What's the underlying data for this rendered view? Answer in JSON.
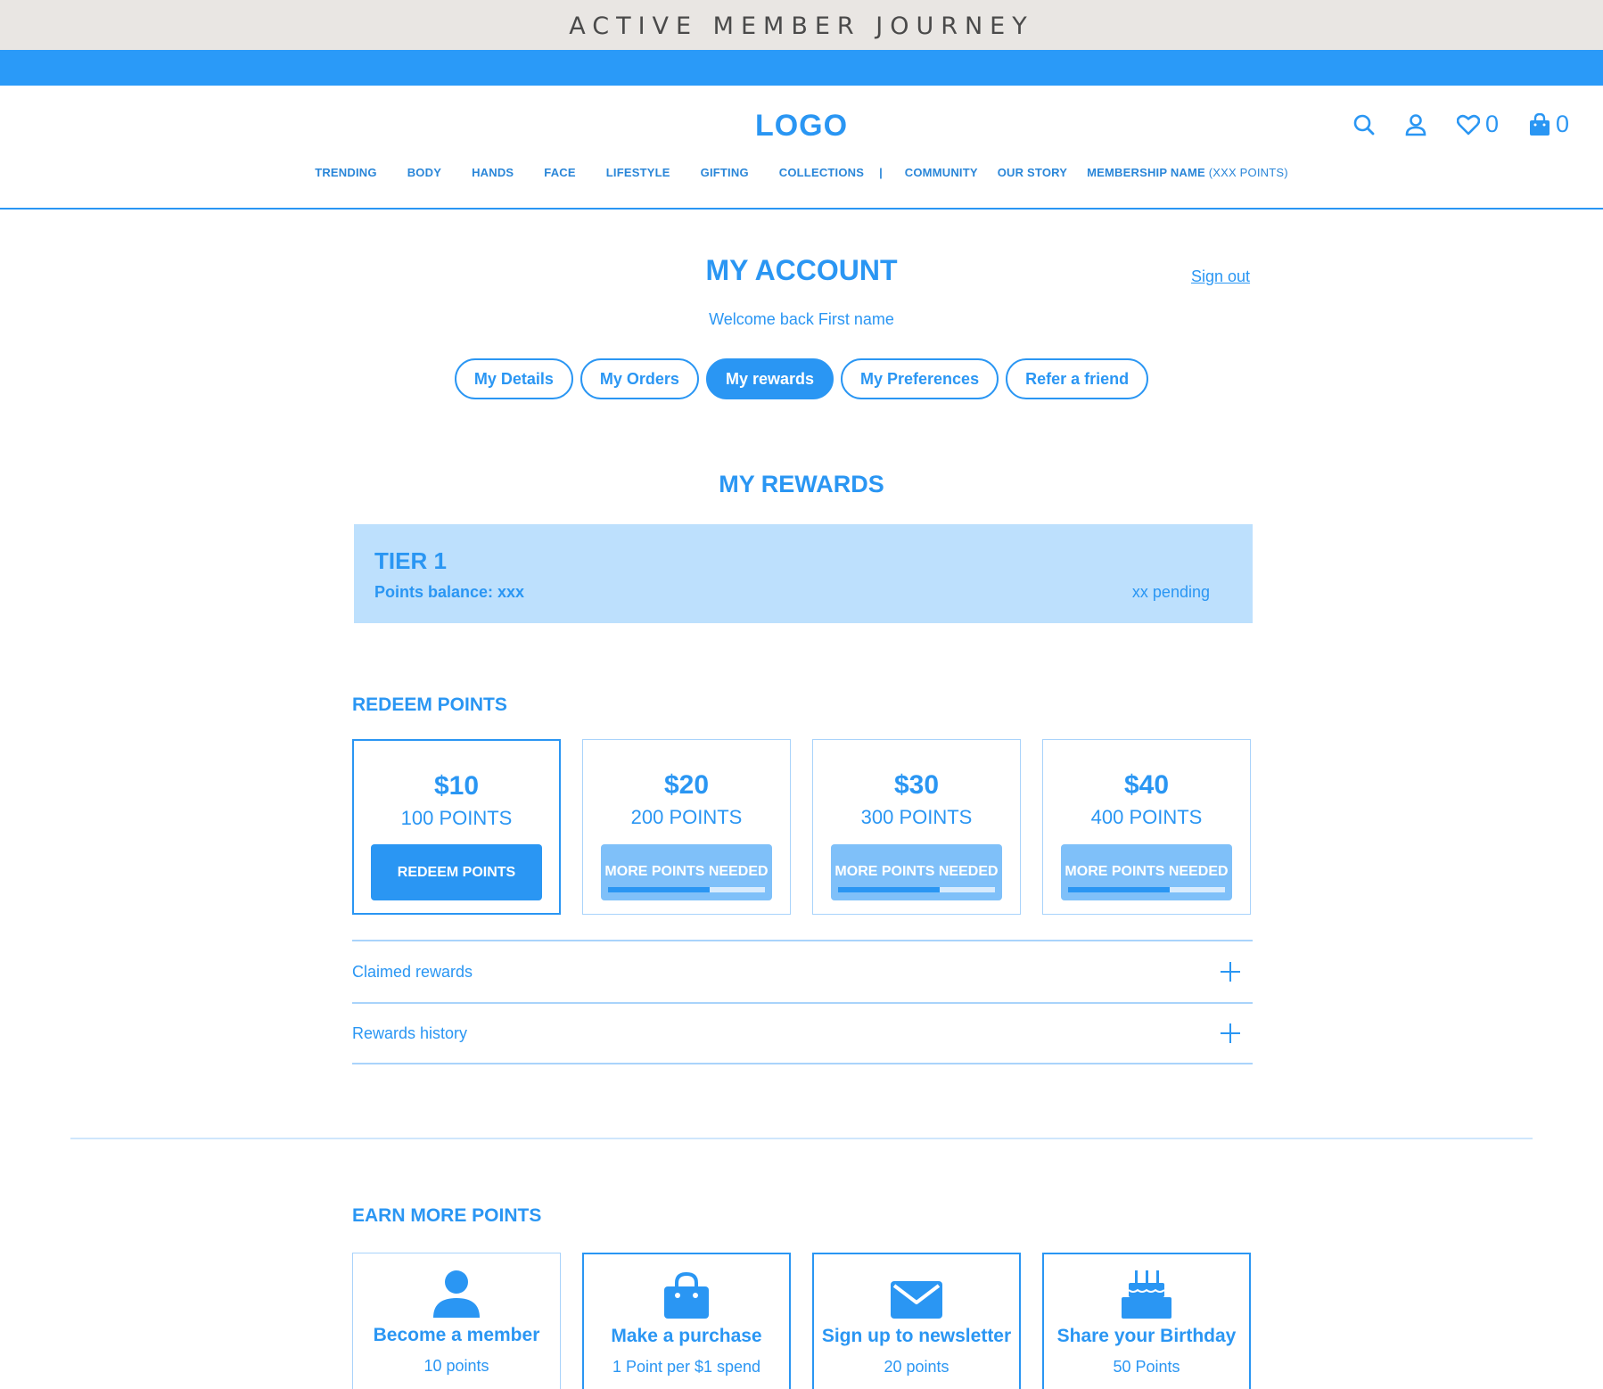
{
  "banner": {
    "title": "ACTIVE MEMBER JOURNEY"
  },
  "header": {
    "logo": "LOGO",
    "wishlist_count": "0",
    "cart_count": "0"
  },
  "nav": {
    "items": [
      "TRENDING",
      "BODY",
      "HANDS",
      "FACE",
      "LIFESTYLE",
      "GIFTING",
      "COLLECTIONS"
    ],
    "separator": "|",
    "secondary": [
      "COMMUNITY",
      "OUR STORY"
    ],
    "membership_name": "MEMBERSHIP NAME",
    "membership_points": "(XXX POINTS)"
  },
  "account": {
    "title": "MY ACCOUNT",
    "sign_out": "Sign out",
    "welcome": "Welcome back First name",
    "tabs": [
      {
        "label": "My Details"
      },
      {
        "label": "My Orders"
      },
      {
        "label": "My rewards"
      },
      {
        "label": "My Preferences"
      },
      {
        "label": "Refer a friend"
      }
    ],
    "active_tab": "My rewards"
  },
  "rewards": {
    "title": "MY REWARDS",
    "tier": {
      "name": "TIER 1",
      "balance": "Points balance: xxx",
      "pending": "xx pending"
    },
    "redeem": {
      "title": "REDEEM POINTS",
      "cards": [
        {
          "value": "$10",
          "points": "100 POINTS",
          "button": "REDEEM POINTS",
          "enabled": true
        },
        {
          "value": "$20",
          "points": "200 POINTS",
          "button": "MORE POINTS NEEDED",
          "enabled": false,
          "progress": 0.65
        },
        {
          "value": "$30",
          "points": "300 POINTS",
          "button": "MORE POINTS NEEDED",
          "enabled": false,
          "progress": 0.65
        },
        {
          "value": "$40",
          "points": "400 POINTS",
          "button": "MORE POINTS NEEDED",
          "enabled": false,
          "progress": 0.65
        }
      ]
    },
    "accordions": [
      {
        "label": "Claimed rewards"
      },
      {
        "label": "Rewards history"
      }
    ]
  },
  "earn": {
    "title": "EARN MORE POINTS",
    "cards": [
      {
        "icon": "person-icon",
        "title": "Become a member",
        "points": "10 points"
      },
      {
        "icon": "shopping-bag-icon",
        "title": "Make a purchase",
        "points": "1 Point per $1 spend"
      },
      {
        "icon": "envelope-icon",
        "title": "Sign up to newsletter",
        "points": "20 points"
      },
      {
        "icon": "birthday-cake-icon",
        "title": "Share your Birthday",
        "points": "50 Points"
      }
    ]
  },
  "colors": {
    "primary": "#2a96f3",
    "band": "#2a9af8",
    "tier_bg": "#bde0fd",
    "disabled_btn": "#7fc0f9",
    "banner_bg": "#e9e6e3"
  }
}
